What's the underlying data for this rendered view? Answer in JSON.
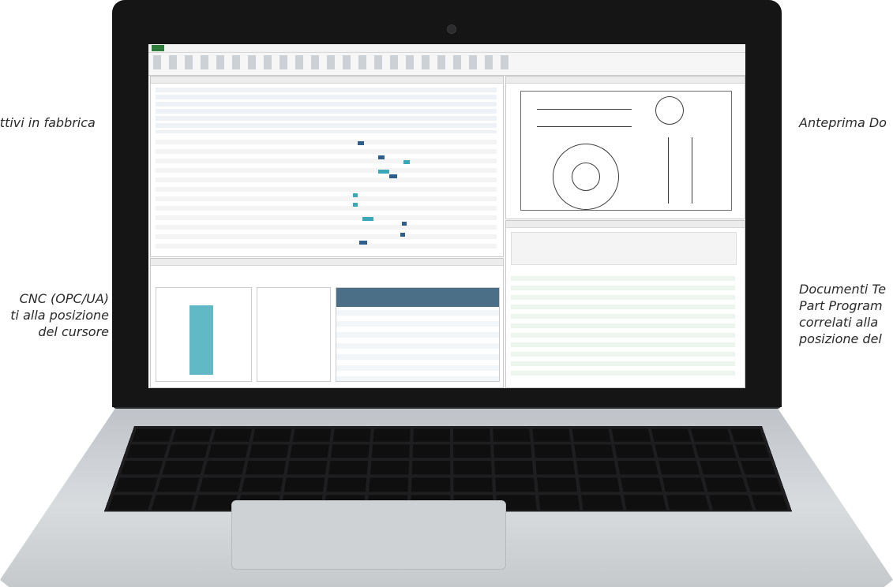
{
  "captions": {
    "left_top": "attivi in fabbrica",
    "left_bottom_1": "CNC (OPC/UA)",
    "left_bottom_2": "ti alla posizione",
    "left_bottom_3": "del cursore",
    "right_top": "Anteprima Do",
    "right_bottom_1": "Documenti Te",
    "right_bottom_2": "Part Program",
    "right_bottom_3": "correlati alla",
    "right_bottom_4": "posizione del"
  },
  "colors": {
    "ribbon_accent": "#2f7d3a",
    "gantt_blue": "#2f5d8c",
    "gantt_cyan": "#3aa8b8",
    "table_header": "#4b6f86"
  }
}
